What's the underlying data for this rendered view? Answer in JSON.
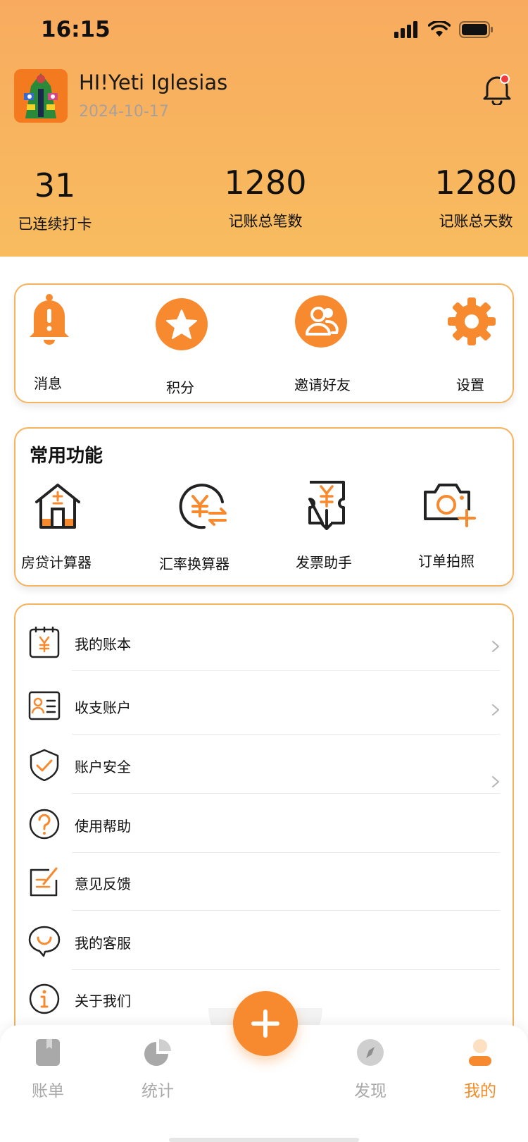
{
  "status_bar": {
    "time": "16:15"
  },
  "profile": {
    "greeting": "HI!Yeti Iglesias",
    "date": "2024-10-17"
  },
  "stats": [
    {
      "value": "31",
      "label": "已连续打卡"
    },
    {
      "value": "1280",
      "label": "记账总笔数"
    },
    {
      "value": "1280",
      "label": "记账总天数"
    }
  ],
  "quick_actions": [
    {
      "label": "消息",
      "icon": "bell-alert-icon"
    },
    {
      "label": "积分",
      "icon": "star-icon"
    },
    {
      "label": "邀请好友",
      "icon": "users-icon"
    },
    {
      "label": "设置",
      "icon": "gear-icon"
    }
  ],
  "common_functions": {
    "title": "常用功能",
    "items": [
      {
        "label": "房贷计算器",
        "icon": "house-calculator-icon"
      },
      {
        "label": "汇率换算器",
        "icon": "currency-exchange-icon"
      },
      {
        "label": "发票助手",
        "icon": "invoice-icon"
      },
      {
        "label": "订单拍照",
        "icon": "camera-add-icon"
      }
    ]
  },
  "menu": [
    {
      "label": "我的账本",
      "icon": "ledger-icon"
    },
    {
      "label": "收支账户",
      "icon": "account-card-icon"
    },
    {
      "label": "账户安全",
      "icon": "shield-check-icon"
    },
    {
      "label": "使用帮助",
      "icon": "help-icon"
    },
    {
      "label": "意见反馈",
      "icon": "feedback-icon"
    },
    {
      "label": "我的客服",
      "icon": "customer-service-icon"
    },
    {
      "label": "关于我们",
      "icon": "info-icon"
    }
  ],
  "tabbar": {
    "tabs": [
      {
        "label": "账单",
        "icon": "bill-icon"
      },
      {
        "label": "统计",
        "icon": "pie-chart-icon"
      },
      {
        "label": "发现",
        "icon": "compass-icon"
      },
      {
        "label": "我的",
        "icon": "person-icon"
      }
    ],
    "active": "我的"
  },
  "colors": {
    "accent": "#f58a26",
    "header_top": "#f8ab5f",
    "header_bottom": "#f8bc5f",
    "card_border": "#f6b35d",
    "inactive": "#a9a9a9"
  }
}
